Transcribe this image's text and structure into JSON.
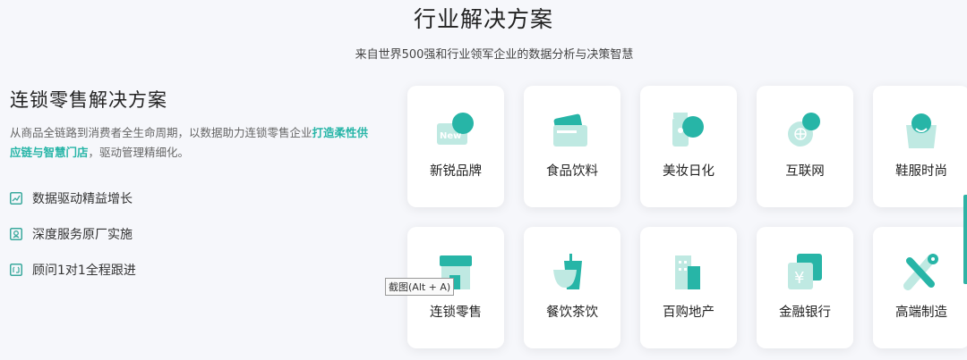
{
  "header": {
    "title": "行业解决方案",
    "subtitle": "来自世界500强和行业领军企业的数据分析与决策智慧"
  },
  "solution": {
    "title": "连锁零售解决方案",
    "desc_part1": "从商品全链路到消费者全生命周期，以数据助力连锁零售企业",
    "desc_highlight": "打造柔性供应链与智慧门店",
    "desc_part2": "，驱动管理精细化。",
    "features": [
      {
        "icon": "chart-line-icon",
        "label": "数据驱动精益增长"
      },
      {
        "icon": "service-icon",
        "label": "深度服务原厂实施"
      },
      {
        "icon": "consultant-icon",
        "label": "顾问1对1全程跟进"
      }
    ]
  },
  "industries": [
    {
      "label": "新锐品牌",
      "icon": "new-brand-icon",
      "badge": "New"
    },
    {
      "label": "食品饮料",
      "icon": "food-beverage-icon"
    },
    {
      "label": "美妆日化",
      "icon": "cosmetics-icon"
    },
    {
      "label": "互联网",
      "icon": "internet-icon"
    },
    {
      "label": "鞋服时尚",
      "icon": "fashion-bag-icon"
    },
    {
      "label": "连锁零售",
      "icon": "retail-store-icon"
    },
    {
      "label": "餐饮茶饮",
      "icon": "catering-drink-icon"
    },
    {
      "label": "百购地产",
      "icon": "real-estate-icon"
    },
    {
      "label": "金融银行",
      "icon": "finance-bank-icon",
      "symbol": "¥"
    },
    {
      "label": "高端制造",
      "icon": "manufacturing-icon"
    }
  ],
  "tooltip": "截图(Alt + A)",
  "colors": {
    "accent": "#27b5a7",
    "accent_light": "#bfe9e2"
  }
}
